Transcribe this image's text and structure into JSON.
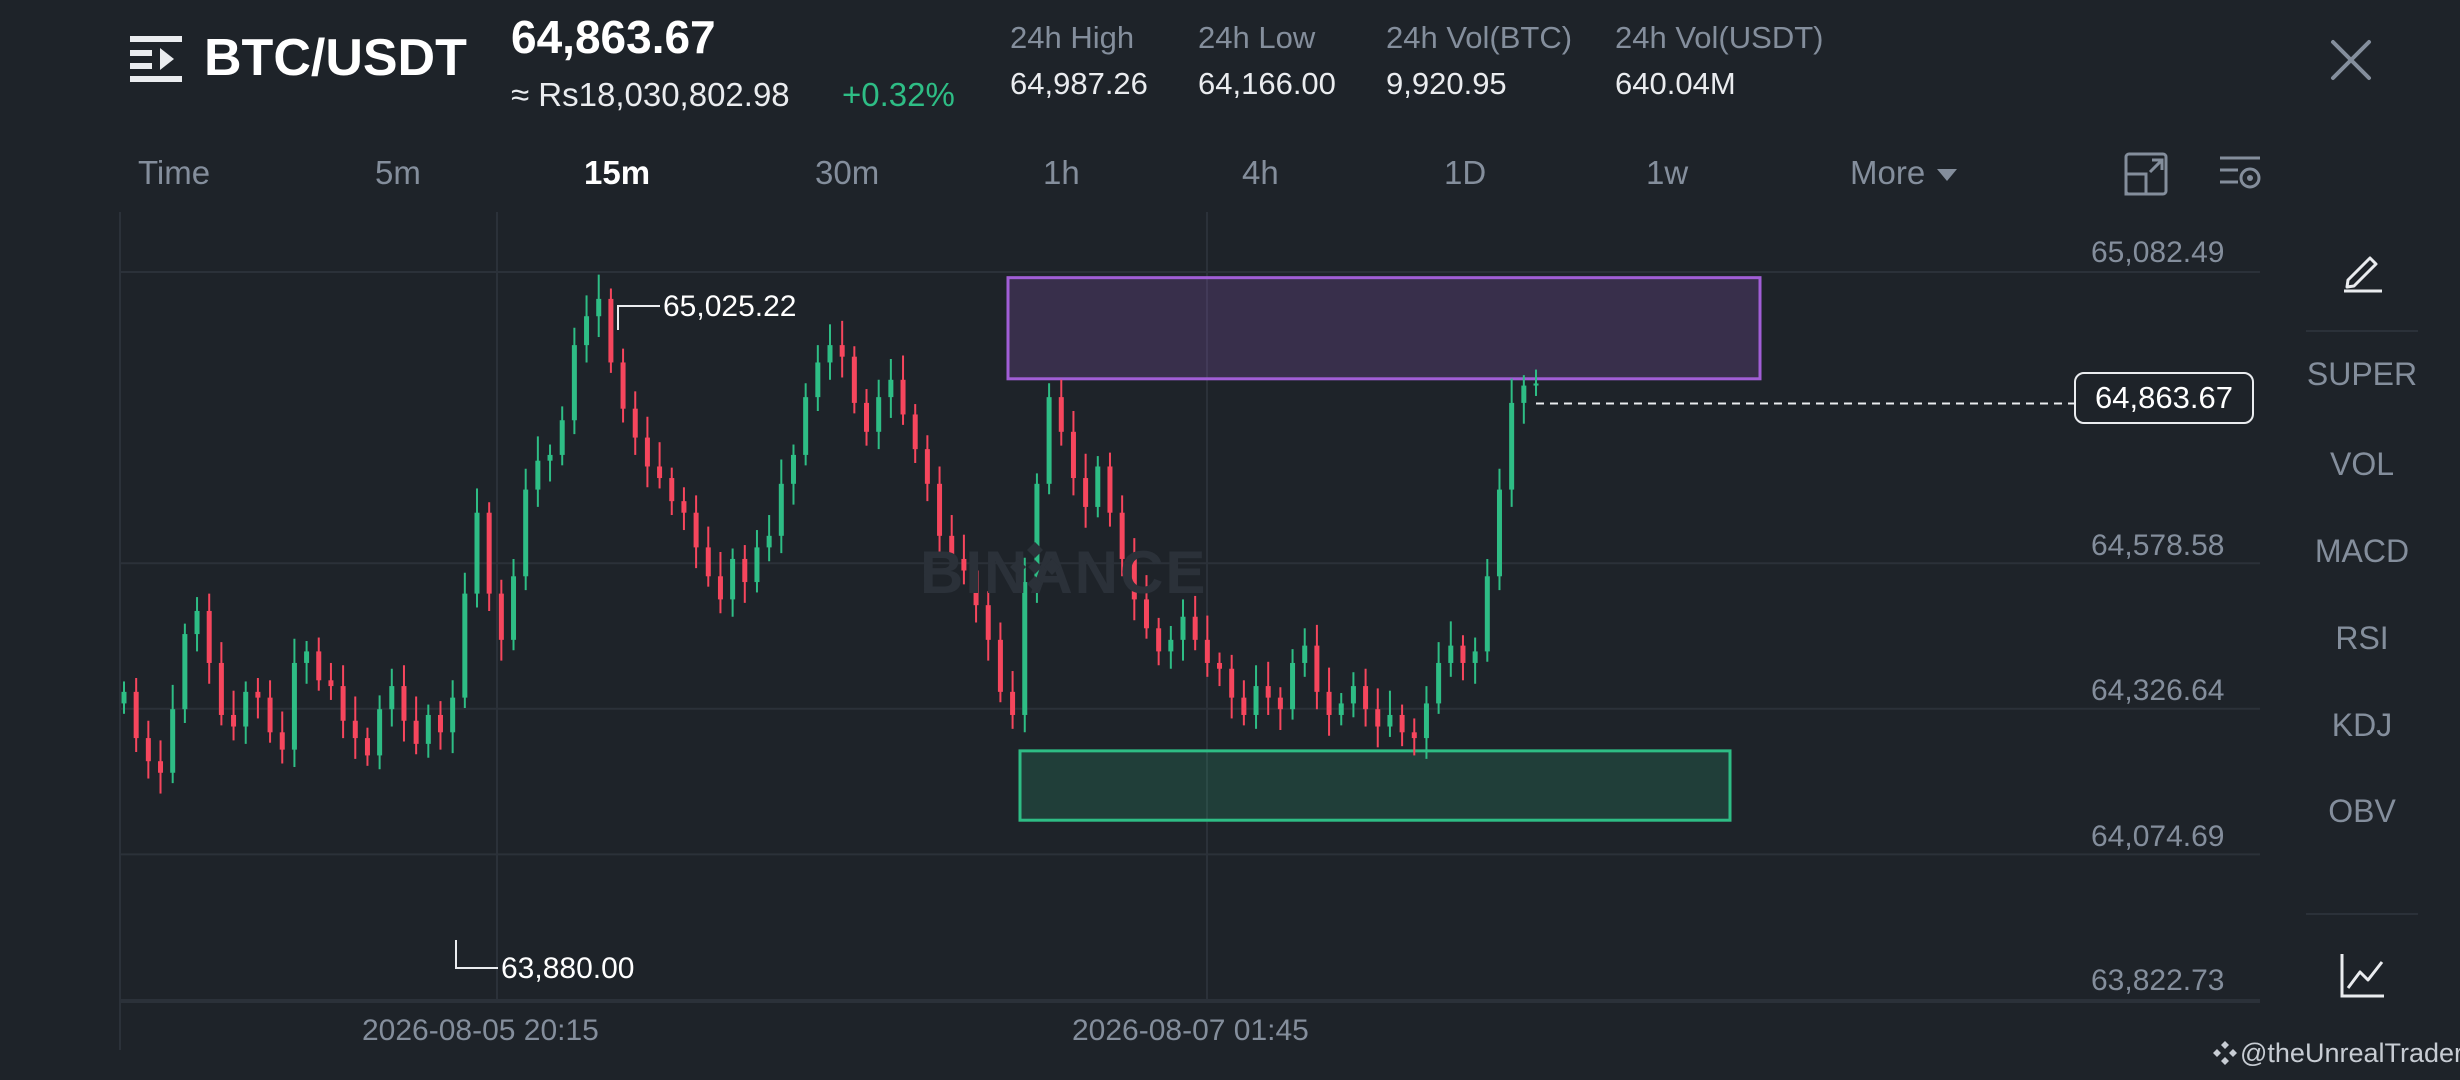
{
  "header": {
    "pair": "BTC/USDT",
    "last_price": "64,863.67",
    "approx_fiat": "≈ Rs18,030,802.98",
    "change": "+0.32%",
    "stats": [
      {
        "label": "24h High",
        "value": "64,987.26"
      },
      {
        "label": "24h Low",
        "value": "64,166.00"
      },
      {
        "label": "24h Vol(BTC)",
        "value": "9,920.95"
      },
      {
        "label": "24h Vol(USDT)",
        "value": "640.04M"
      }
    ]
  },
  "timeframes": [
    "Time",
    "5m",
    "15m",
    "30m",
    "1h",
    "4h",
    "1D",
    "1w"
  ],
  "active_timeframe": "15m",
  "more_label": "More",
  "indicators": [
    "SUPER",
    "VOL",
    "MACD",
    "RSI",
    "KDJ",
    "OBV"
  ],
  "watermark": "BINANCE",
  "credit": "@theUnrealTrader",
  "colors": {
    "background": "#1e2329",
    "up": "#2ebd85",
    "down": "#f6465d",
    "resistance_zone": "#a15ed6",
    "support_zone": "#2ebd85"
  },
  "chart_data": {
    "type": "candlestick",
    "current_price": "64,863.67",
    "y_ticks": [
      "65,082.49",
      "64,578.58",
      "64,326.64",
      "64,074.69",
      "63,822.73"
    ],
    "x_ticks": [
      "2026-08-05 20:15",
      "2026-08-07 01:45"
    ],
    "high_marker": "65,025.22",
    "low_marker": "63,880.00",
    "zones": [
      {
        "name": "resistance",
        "from": 64870,
        "to": 65045
      },
      {
        "name": "support",
        "from": 64120,
        "to": 64240
      }
    ],
    "closes": [
      64330,
      64250,
      64210,
      64190,
      64300,
      64430,
      64470,
      64380,
      64290,
      64270,
      64330,
      64320,
      64260,
      64230,
      64380,
      64400,
      64350,
      64340,
      64280,
      64250,
      64220,
      64300,
      64340,
      64280,
      64240,
      64290,
      64260,
      64320,
      64500,
      64640,
      64500,
      64420,
      64530,
      64680,
      64730,
      64740,
      64800,
      64930,
      64980,
      65010,
      64900,
      64820,
      64770,
      64720,
      64700,
      64660,
      64640,
      64580,
      64530,
      64490,
      64560,
      64520,
      64580,
      64600,
      64690,
      64740,
      64840,
      64900,
      64930,
      64910,
      64830,
      64780,
      64840,
      64870,
      64810,
      64750,
      64690,
      64600,
      64560,
      64540,
      64480,
      64420,
      64330,
      64290,
      64520,
      64690,
      64840,
      64780,
      64700,
      64650,
      64720,
      64640,
      64560,
      64490,
      64440,
      64400,
      64420,
      64460,
      64420,
      64380,
      64370,
      64320,
      64290,
      64340,
      64320,
      64300,
      64380,
      64410,
      64330,
      64290,
      64310,
      64340,
      64300,
      64270,
      64290,
      64260,
      64250,
      64310,
      64380,
      64410,
      64380,
      64400,
      64530,
      64680,
      64830,
      64860,
      64863.67
    ]
  }
}
